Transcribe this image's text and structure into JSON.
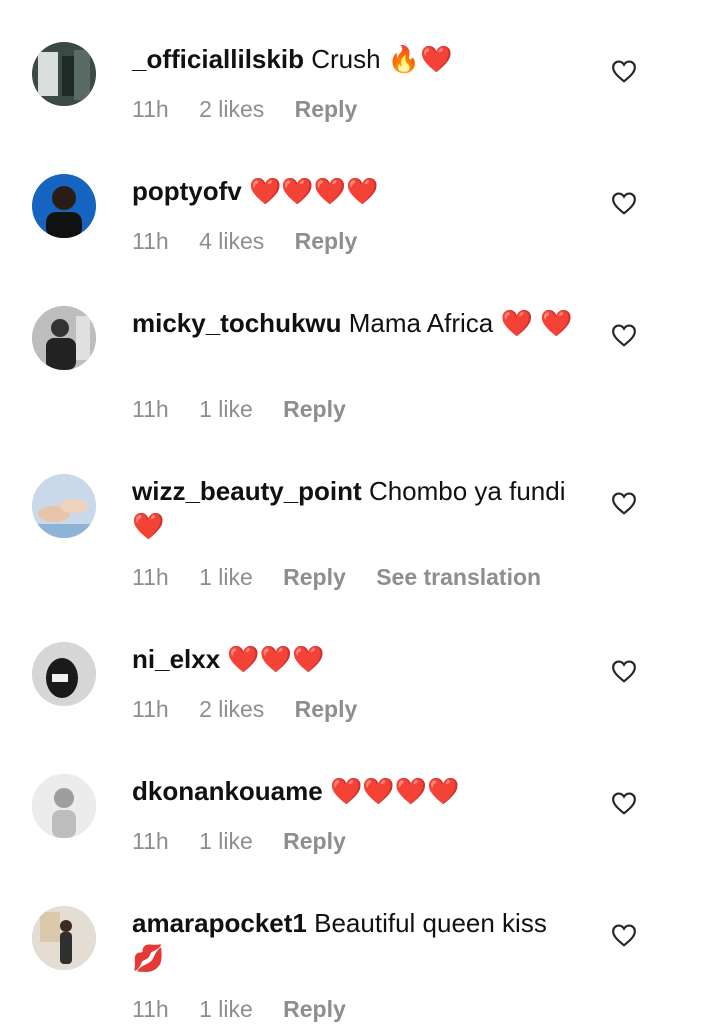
{
  "comments": [
    {
      "username": "_officiallilskib",
      "text": "Crush 🔥❤️",
      "time": "11h",
      "likes": "2 likes",
      "reply": "Reply",
      "avatar_color": "#5b6b63"
    },
    {
      "username": "poptyofv",
      "text": "❤️❤️❤️❤️",
      "time": "11h",
      "likes": "4 likes",
      "reply": "Reply",
      "avatar_color": "#1565c0"
    },
    {
      "username": "micky_tochukwu",
      "text": "Mama Africa ❤️ ❤️",
      "time": "11h",
      "likes": "1 like",
      "reply": "Reply",
      "avatar_color": "#9e9e9e"
    },
    {
      "username": "wizz_beauty_point",
      "text": "Chombo ya fundi❤️",
      "time": "11h",
      "likes": "1 like",
      "reply": "Reply",
      "translate": "See translation",
      "avatar_color": "#b0c4de"
    },
    {
      "username": "ni_elxx",
      "text": "❤️❤️❤️",
      "time": "11h",
      "likes": "2 likes",
      "reply": "Reply",
      "avatar_color": "#d8d8d8"
    },
    {
      "username": "dkonankouame",
      "text": "❤️❤️❤️❤️",
      "time": "11h",
      "likes": "1 like",
      "reply": "Reply",
      "avatar_color": "#e6e6e6"
    },
    {
      "username": "amarapocket1",
      "text": "Beautiful queen kiss 💋",
      "time": "11h",
      "likes": "1 like",
      "reply": "Reply",
      "avatar_color": "#cfc6b8"
    }
  ]
}
